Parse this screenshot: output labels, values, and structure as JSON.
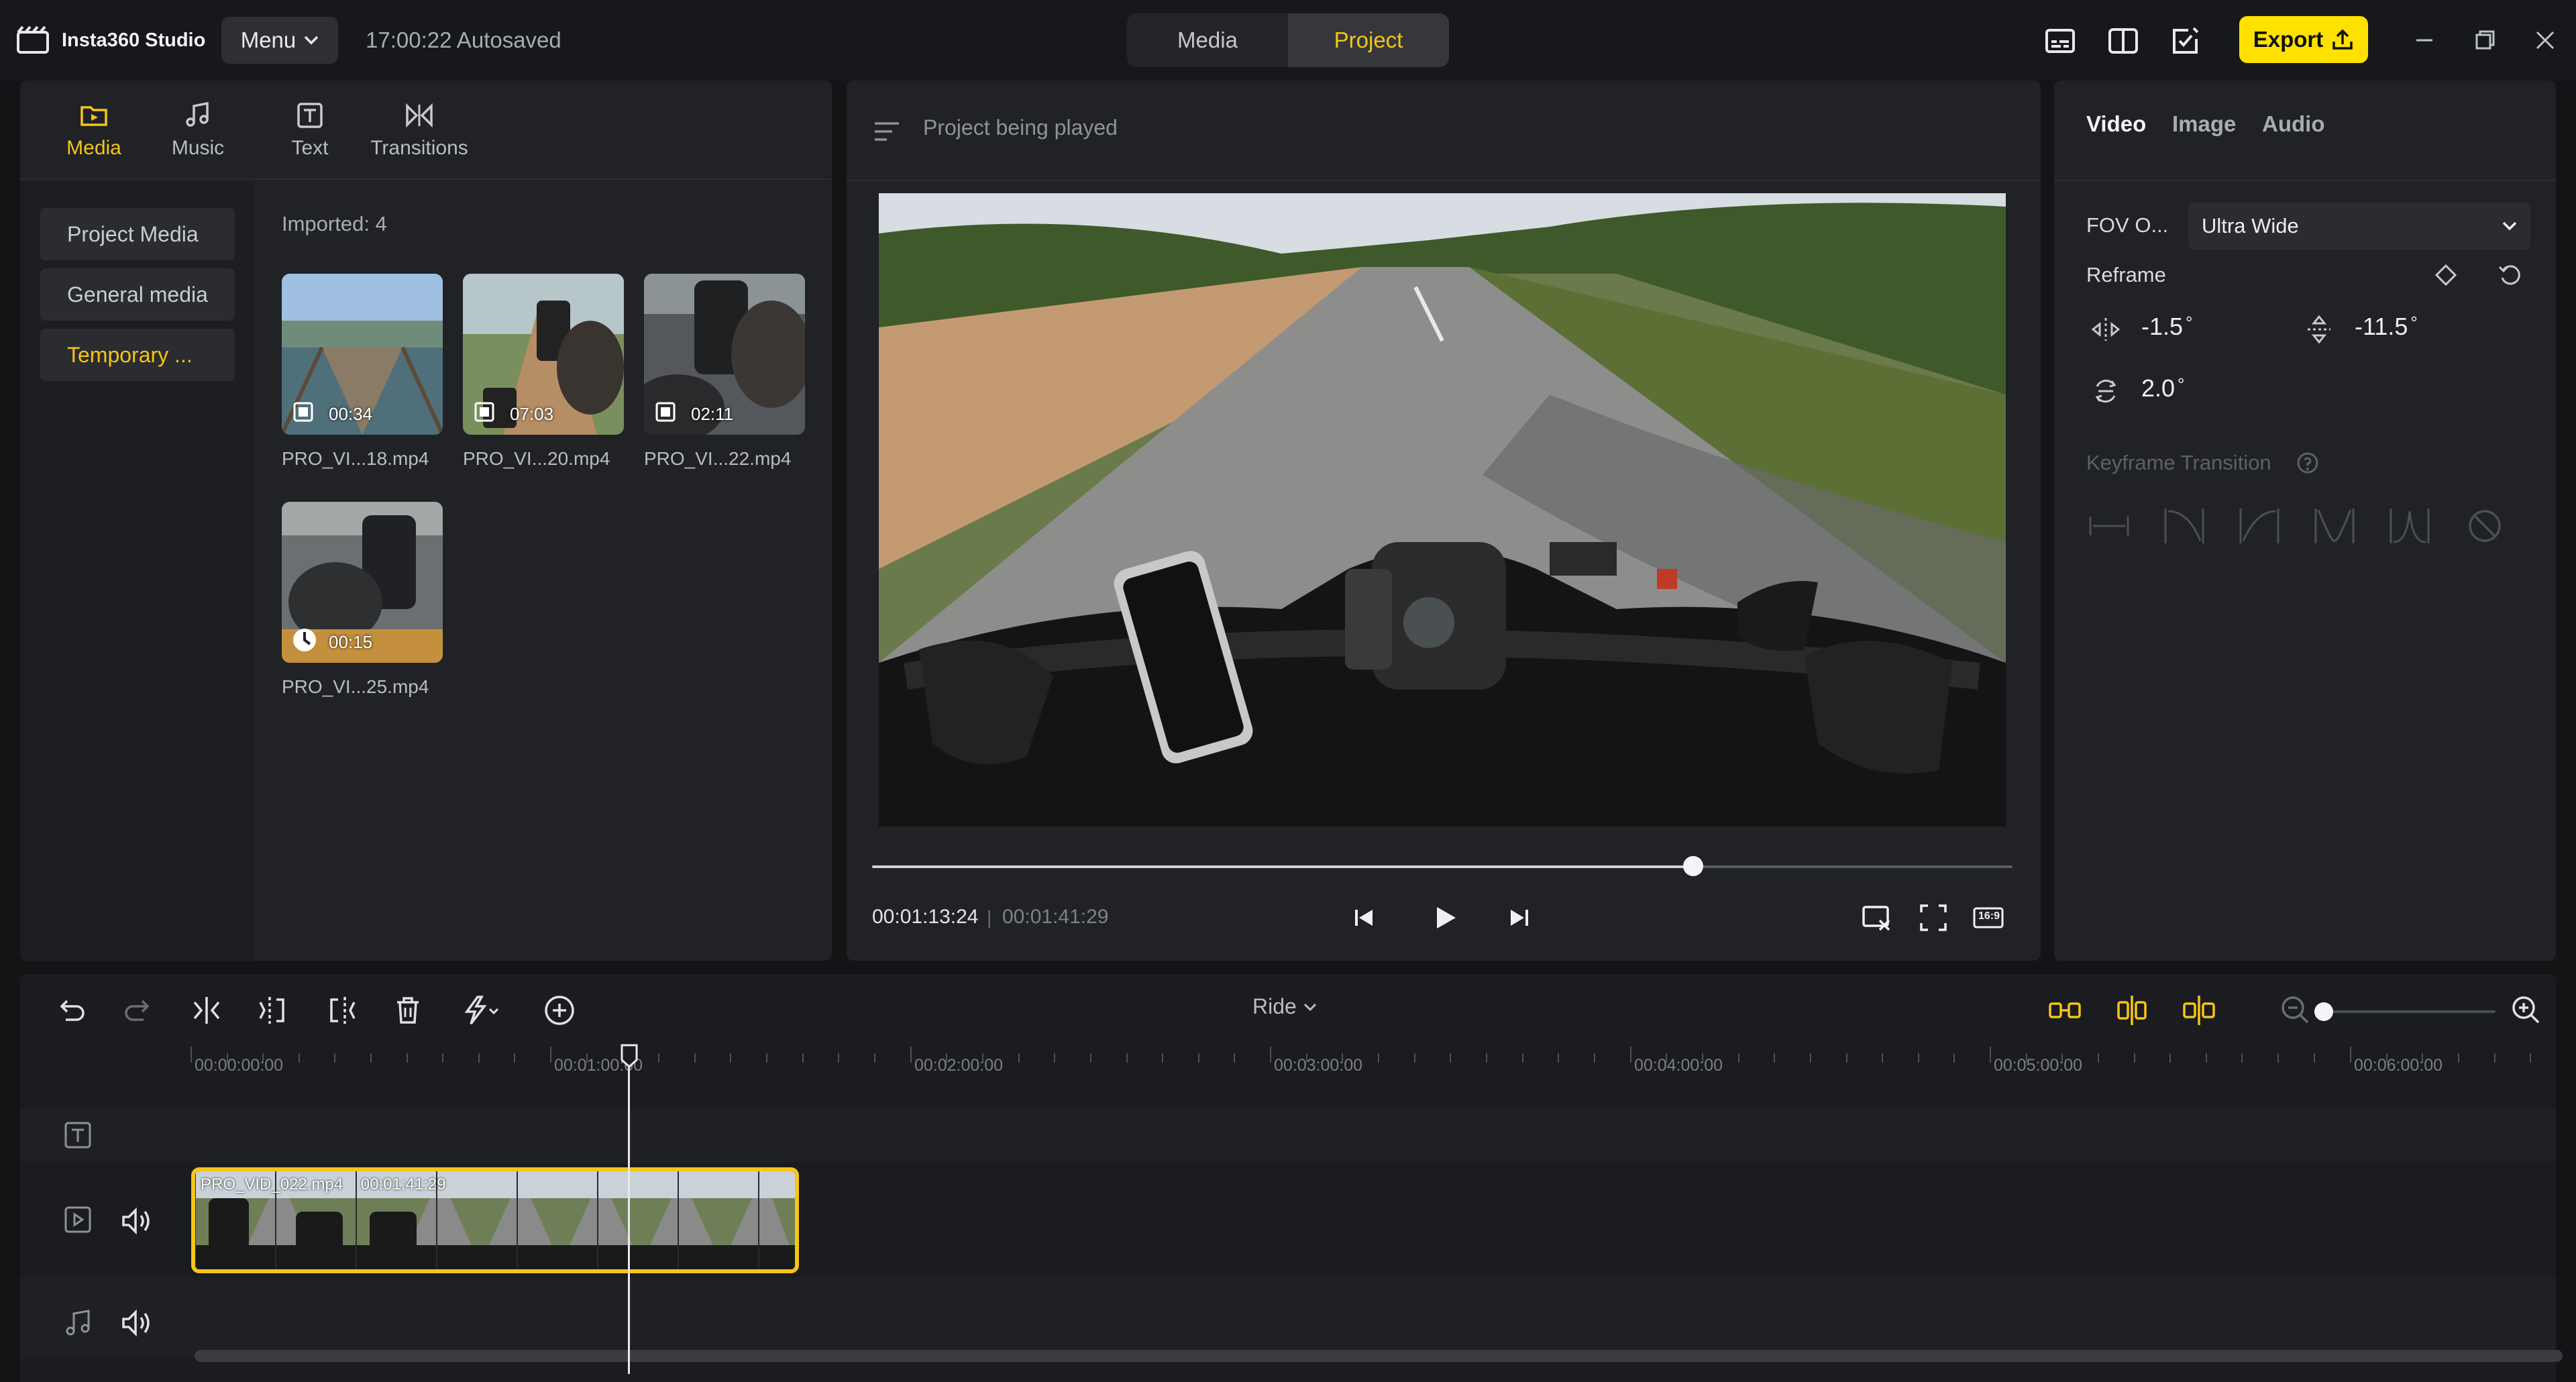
{
  "app": {
    "name": "Insta360 Studio",
    "menu_label": "Menu",
    "autosave": "17:00:22 Autosaved"
  },
  "mode_tabs": [
    {
      "label": "Media",
      "active": false
    },
    {
      "label": "Project",
      "active": true
    }
  ],
  "toolbar_icons": [
    "subtitle-icon",
    "compare-view-icon",
    "edit-note-icon"
  ],
  "export_label": "Export",
  "colors": {
    "accent": "#f5c518",
    "export_bg": "#ffe100",
    "panel_bg": "#202226",
    "app_bg": "#131416"
  },
  "left_panel": {
    "tabs": [
      {
        "label": "Media",
        "icon": "media-folder-icon",
        "active": true
      },
      {
        "label": "Music",
        "icon": "music-note-icon",
        "active": false
      },
      {
        "label": "Text",
        "icon": "text-icon",
        "active": false
      },
      {
        "label": "Transitions",
        "icon": "transitions-icon",
        "active": false
      }
    ],
    "sidebar": [
      {
        "label": "Project Media",
        "active": false
      },
      {
        "label": "General media",
        "active": false
      },
      {
        "label": "Temporary ...",
        "active": true
      }
    ],
    "imported": "Imported: 4",
    "media": [
      {
        "name": "PRO_VI...18.mp4",
        "duration": "00:34",
        "type": "video-clip-icon"
      },
      {
        "name": "PRO_VI...20.mp4",
        "duration": "07:03",
        "type": "video-clip-icon"
      },
      {
        "name": "PRO_VI...22.mp4",
        "duration": "02:11",
        "type": "video-clip-icon"
      },
      {
        "name": "PRO_VI...25.mp4",
        "duration": "00:15",
        "type": "timelapse-icon"
      }
    ]
  },
  "preview": {
    "header": "Project being played",
    "current_time": "00:01:13:24",
    "time_separator": "|",
    "total_time": "00:01:41:29",
    "progress": 0.72,
    "aspect_ratio": "16:9"
  },
  "right_panel": {
    "tabs": [
      {
        "label": "Video",
        "active": true
      },
      {
        "label": "Image",
        "active": false
      },
      {
        "label": "Audio",
        "active": false
      }
    ],
    "fov_label": "FOV O...",
    "fov_value": "Ultra Wide",
    "reframe_label": "Reframe",
    "pan": "-1.5",
    "tilt": "-11.5",
    "roll": "2.0",
    "degree": "°",
    "keyframe_label": "Keyframe Transition"
  },
  "timeline": {
    "preset": "Ride",
    "ruler": [
      "00:00:00:00",
      "00:01:00:00",
      "00:02:00:00",
      "00:03:00:00",
      "00:04:00:00",
      "00:05:00:00",
      "00:06:00:00"
    ],
    "clip_name": "PRO_VID_022.mp4",
    "clip_duration": "00:01:41:29",
    "zoom_level": 0.0
  }
}
